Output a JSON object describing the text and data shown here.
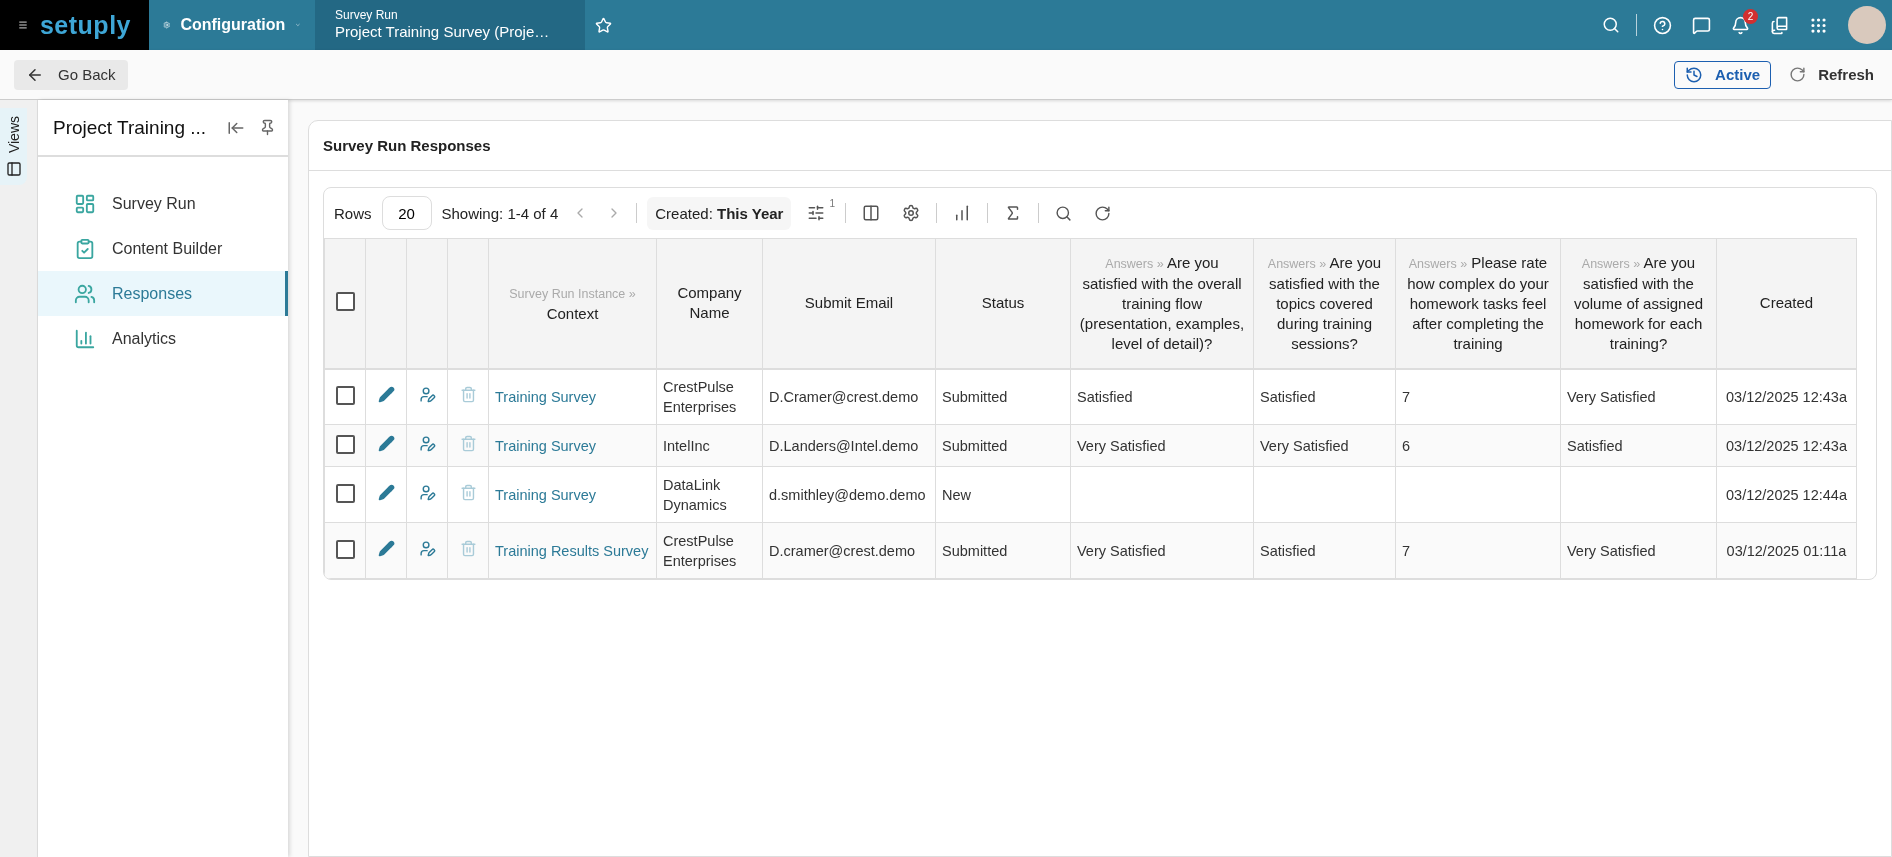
{
  "top_bar": {
    "logo": "setuply",
    "module": "Configuration",
    "breadcrumb": {
      "caption": "Survey Run",
      "title": "Project Training Survey (Proje…"
    },
    "notification_count": "2"
  },
  "action_bar": {
    "back": "Go Back",
    "status": "Active",
    "refresh": "Refresh"
  },
  "views_tab": "Views",
  "sidebar": {
    "title": "Project Training ...",
    "items": [
      {
        "label": "Survey Run",
        "selected": false
      },
      {
        "label": "Content Builder",
        "selected": false
      },
      {
        "label": "Responses",
        "selected": true
      },
      {
        "label": "Analytics",
        "selected": false
      }
    ]
  },
  "panel": {
    "title": "Survey Run Responses"
  },
  "toolbar": {
    "rows_label": "Rows",
    "rows_value": "20",
    "showing": "Showing: 1-4 of 4",
    "filter_label": "Created:",
    "filter_value": "This Year",
    "filter_count": "1"
  },
  "table": {
    "all_checked": false,
    "columns": [
      {
        "prefix": "Survey Run Instance »",
        "title": "Context"
      },
      {
        "title": "Company Name"
      },
      {
        "title": "Submit Email"
      },
      {
        "title": "Status"
      },
      {
        "prefix": "Answers »",
        "title": "Are you satisfied with the overall training flow (presentation, examples, level of detail)?"
      },
      {
        "prefix": "Answers »",
        "title": "Are you satisfied with the topics covered during training sessions?"
      },
      {
        "prefix": "Answers »",
        "title": "Please rate how complex do your homework tasks feel after completing the training"
      },
      {
        "prefix": "Answers »",
        "title": "Are you satisfied with the volume of assigned homework for each training?"
      },
      {
        "title": "Created"
      }
    ],
    "rows": [
      {
        "checked": false,
        "cells": [
          "Training Survey",
          "CrestPulse Enterprises",
          "D.Cramer@crest.demo",
          "Submitted",
          "Satisfied",
          "Satisfied",
          "7",
          "Very Satisfied",
          "03/12/2025 12:43a"
        ]
      },
      {
        "checked": false,
        "cells": [
          "Training Survey",
          "IntelInc",
          "D.Landers@Intel.demo",
          "Submitted",
          "Very Satisfied",
          "Very Satisfied",
          "6",
          "Satisfied",
          "03/12/2025 12:43a"
        ]
      },
      {
        "checked": false,
        "cells": [
          "Training Survey",
          "DataLink Dynamics",
          "d.smithley@demo.demo",
          "New",
          "",
          "",
          "",
          "",
          "03/12/2025 12:44a"
        ]
      },
      {
        "checked": false,
        "cells": [
          "Training Results Survey",
          "CrestPulse Enterprises",
          "D.cramer@crest.demo",
          "Submitted",
          "Very Satisfied",
          "Satisfied",
          "7",
          "Very Satisfied",
          "03/12/2025 01:11a"
        ]
      }
    ]
  }
}
